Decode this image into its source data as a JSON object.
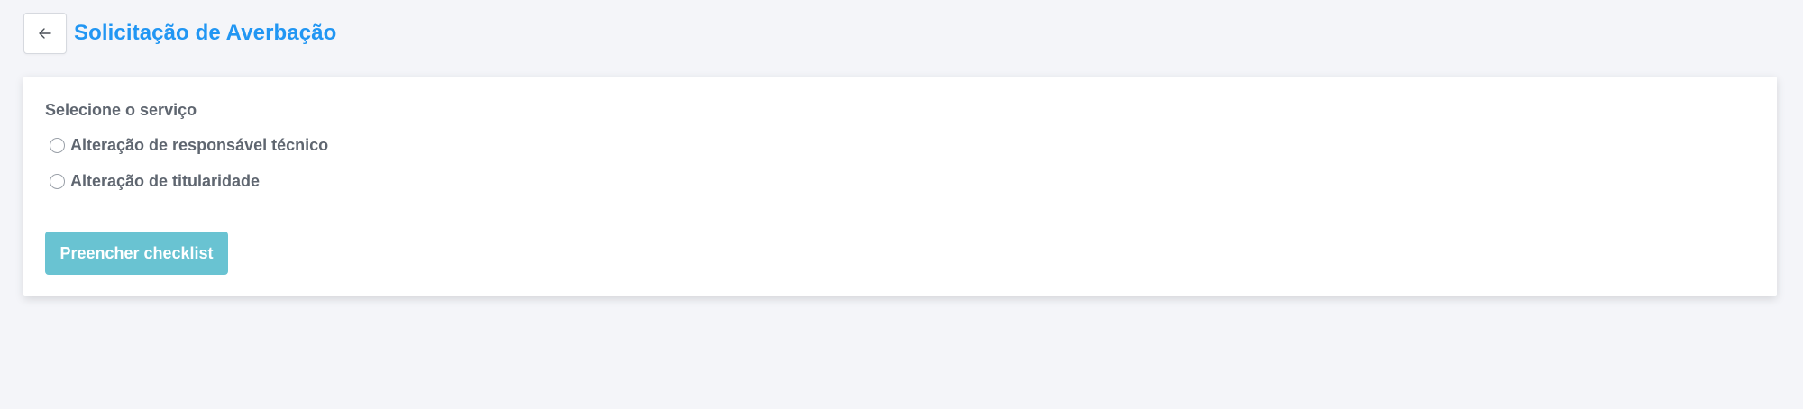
{
  "header": {
    "back_icon": "arrow-left-icon",
    "title": "Solicitação de Averbação"
  },
  "form": {
    "service_label": "Selecione o serviço",
    "options": [
      {
        "label": "Alteração de responsável técnico",
        "selected": false
      },
      {
        "label": "Alteração de titularidade",
        "selected": false
      }
    ],
    "submit_label": "Preencher checklist"
  },
  "colors": {
    "title": "#2196f3",
    "button_bg": "#69c3d2",
    "page_bg": "#f4f5f9",
    "text": "#5f6670"
  }
}
